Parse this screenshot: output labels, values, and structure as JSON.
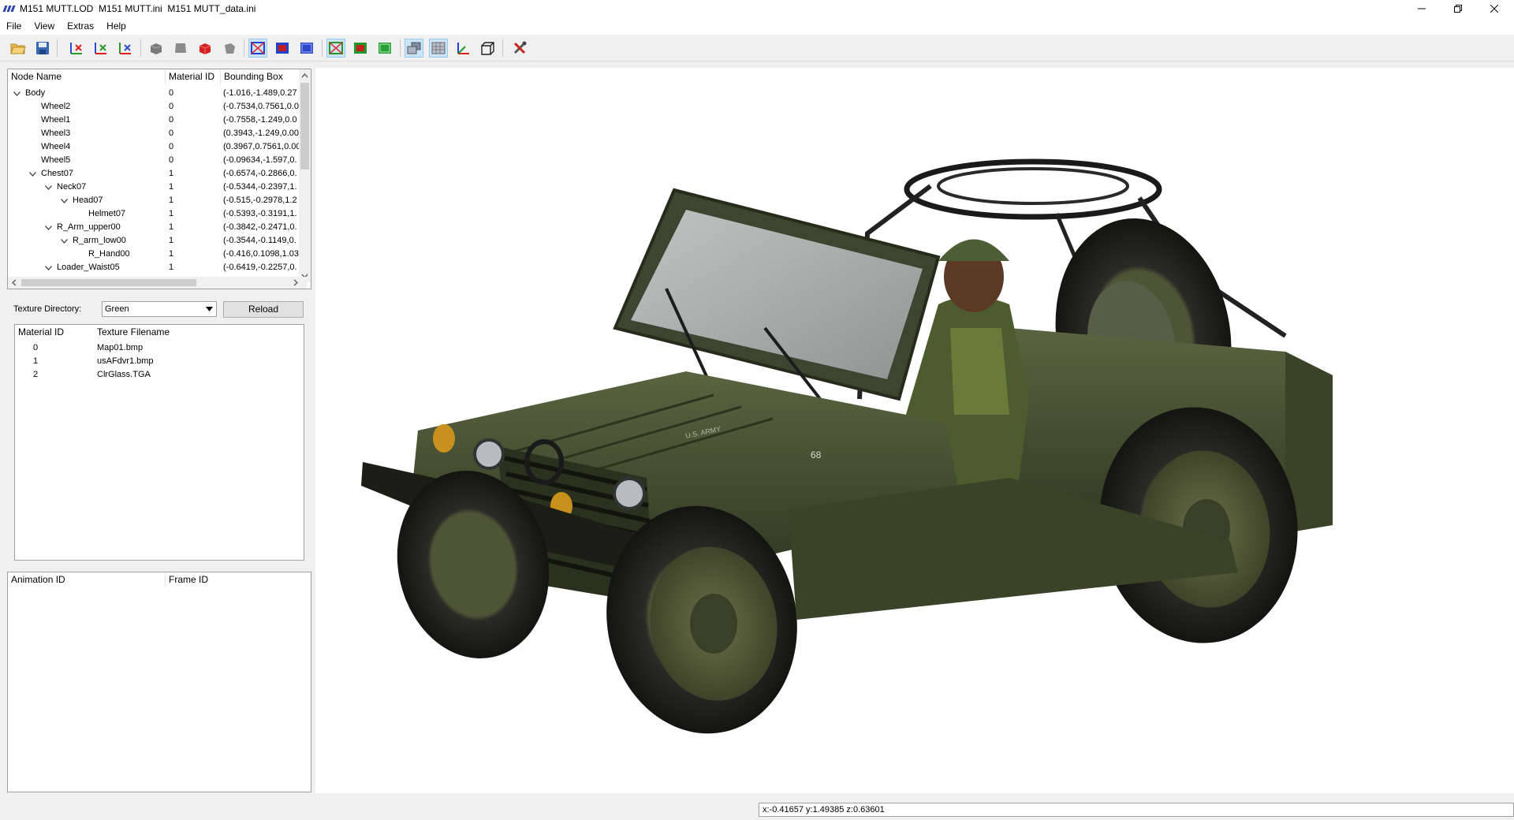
{
  "window": {
    "title": "M151 MUTT.LOD  M151 MUTT.ini  M151 MUTT_data.ini",
    "minimize_glyph": "─",
    "restore_glyph": "❐",
    "close_glyph": "✕"
  },
  "menu": [
    "File",
    "View",
    "Extras",
    "Help"
  ],
  "toolbar": {
    "icons": [
      "open-folder-icon",
      "save-icon",
      "rotate-x-icon",
      "rotate-y-icon",
      "rotate-z-icon",
      "grey-cube-icon",
      "grey-box-icon",
      "red-cube-icon",
      "grey-shape-icon",
      "blue-wire-cube-icon",
      "blue-solid-cube-icon",
      "blue-box-icon",
      "green-wire-cube-icon",
      "green-red-cube-icon",
      "green-box-icon",
      "layers-icon",
      "grid-icon",
      "axes-icon",
      "wire-box-icon",
      "tools-icon"
    ]
  },
  "node_tree": {
    "headers": [
      "Node Name",
      "Material ID",
      "Bounding Box"
    ],
    "rows": [
      {
        "name": "Body",
        "level": 0,
        "expanded": true,
        "material": "0",
        "bbox": "(-1.016,-1.489,0.27"
      },
      {
        "name": "Wheel2",
        "level": 1,
        "expanded": null,
        "material": "0",
        "bbox": "(-0.7534,0.7561,0.0"
      },
      {
        "name": "Wheel1",
        "level": 1,
        "expanded": null,
        "material": "0",
        "bbox": "(-0.7558,-1.249,0.0"
      },
      {
        "name": "Wheel3",
        "level": 1,
        "expanded": null,
        "material": "0",
        "bbox": "(0.3943,-1.249,0.00"
      },
      {
        "name": "Wheel4",
        "level": 1,
        "expanded": null,
        "material": "0",
        "bbox": "(0.3967,0.7561,0.00"
      },
      {
        "name": "Wheel5",
        "level": 1,
        "expanded": null,
        "material": "0",
        "bbox": "(-0.09634,-1.597,0."
      },
      {
        "name": "Chest07",
        "level": 1,
        "expanded": true,
        "material": "1",
        "bbox": "(-0.6574,-0.2866,0."
      },
      {
        "name": "Neck07",
        "level": 2,
        "expanded": true,
        "material": "1",
        "bbox": "(-0.5344,-0.2397,1."
      },
      {
        "name": "Head07",
        "level": 3,
        "expanded": true,
        "material": "1",
        "bbox": "(-0.515,-0.2978,1.2"
      },
      {
        "name": "Helmet07",
        "level": 4,
        "expanded": null,
        "material": "1",
        "bbox": "(-0.5393,-0.3191,1."
      },
      {
        "name": "R_Arm_upper00",
        "level": 2,
        "expanded": true,
        "material": "1",
        "bbox": "(-0.3842,-0.2471,0."
      },
      {
        "name": "R_arm_low00",
        "level": 3,
        "expanded": true,
        "material": "1",
        "bbox": "(-0.3544,-0.1149,0."
      },
      {
        "name": "R_Hand00",
        "level": 4,
        "expanded": null,
        "material": "1",
        "bbox": "(-0.416,0.1098,1.03"
      },
      {
        "name": "Loader_Waist05",
        "level": 2,
        "expanded": true,
        "material": "1",
        "bbox": "(-0.6419,-0.2257,0."
      }
    ]
  },
  "texture": {
    "directory_label": "Texture Directory:",
    "directory_value": "Green",
    "reload_label": "Reload",
    "headers": [
      "Material ID",
      "Texture Filename"
    ],
    "rows": [
      {
        "id": "0",
        "file": "Map01.bmp"
      },
      {
        "id": "1",
        "file": "usAFdvr1.bmp"
      },
      {
        "id": "2",
        "file": "ClrGlass.TGA"
      }
    ]
  },
  "animation": {
    "headers": [
      "Animation ID",
      "Frame ID"
    ],
    "rows": []
  },
  "viewport": {
    "hood_text": "U.S. ARMY",
    "bumper_number": "68"
  },
  "status": {
    "coords": "x:-0.41657 y:1.49385 z:0.63601"
  }
}
